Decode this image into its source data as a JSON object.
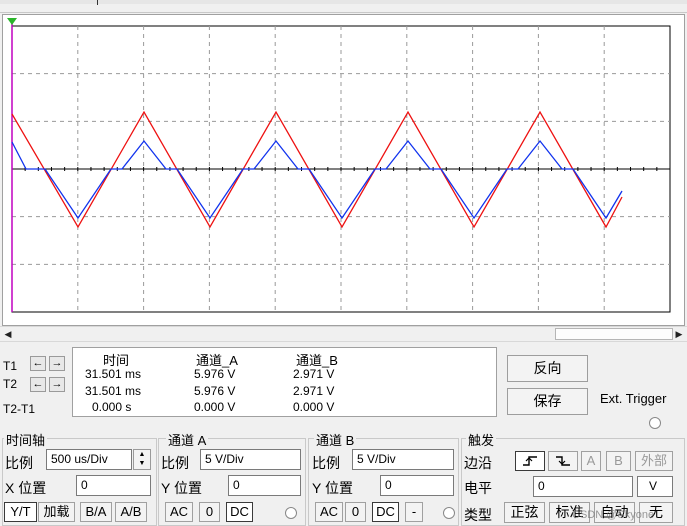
{
  "cursors": {
    "t1_label": "T1",
    "t2_label": "T2",
    "diff_label": "T2-T1"
  },
  "readout": {
    "headers": {
      "time": "时间",
      "ch_a": "通道_A",
      "ch_b": "通道_B"
    },
    "t1": {
      "time": "31.501 ms",
      "a": "5.976 V",
      "b": "2.971 V"
    },
    "t2": {
      "time": "31.501 ms",
      "a": "5.976 V",
      "b": "2.971 V"
    },
    "diff": {
      "time": "0.000 s",
      "a": "0.000 V",
      "b": "0.000 V"
    }
  },
  "actions": {
    "reverse": "反向",
    "save": "保存",
    "ext_trigger": "Ext. Trigger"
  },
  "timebase": {
    "title": "时间轴",
    "scale_label": "比例",
    "scale_value": "500 us/Div",
    "xpos_label": "X 位置",
    "xpos_value": "0",
    "modes": [
      "Y/T",
      "加载",
      "B/A",
      "A/B"
    ]
  },
  "channel_a": {
    "title": "通道 A",
    "scale_label": "比例",
    "scale_value": "5  V/Div",
    "ypos_label": "Y 位置",
    "ypos_value": "0",
    "coupling": [
      "AC",
      "0",
      "DC"
    ]
  },
  "channel_b": {
    "title": "通道 B",
    "scale_label": "比例",
    "scale_value": "5  V/Div",
    "ypos_label": "Y 位置",
    "ypos_value": "0",
    "coupling": [
      "AC",
      "0",
      "DC",
      "-"
    ]
  },
  "trigger": {
    "title": "触发",
    "edge_label": "边沿",
    "edge_buttons": [
      "A",
      "B",
      "外部"
    ],
    "level_label": "电平",
    "level_value": "0",
    "level_unit": "V",
    "type_label": "类型",
    "types": [
      "正弦",
      "标准",
      "自动",
      "无"
    ]
  },
  "watermark": "CSDN @Skyone"
}
